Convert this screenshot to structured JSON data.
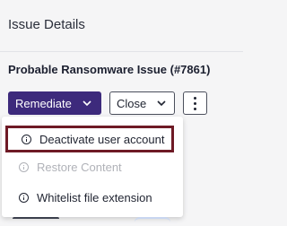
{
  "panel": {
    "title": "Issue Details"
  },
  "issue": {
    "title": "Probable Ransomware Issue (#7861)"
  },
  "actions": {
    "remediate_label": "Remediate",
    "close_label": "Close",
    "more_icon": "more-vertical-icon"
  },
  "menu": {
    "items": [
      {
        "label": "Deactivate user account",
        "icon": "info-icon",
        "state": "focused"
      },
      {
        "label": "Restore Content",
        "icon": "info-icon",
        "state": "disabled"
      },
      {
        "label": "Whitelist file extension",
        "icon": "info-icon",
        "state": "normal"
      }
    ]
  },
  "colors": {
    "primary": "#3d2a7c",
    "focus_outline": "#6e1a25",
    "disabled_text": "#b0b2b8",
    "background": "#f5f5f6"
  }
}
